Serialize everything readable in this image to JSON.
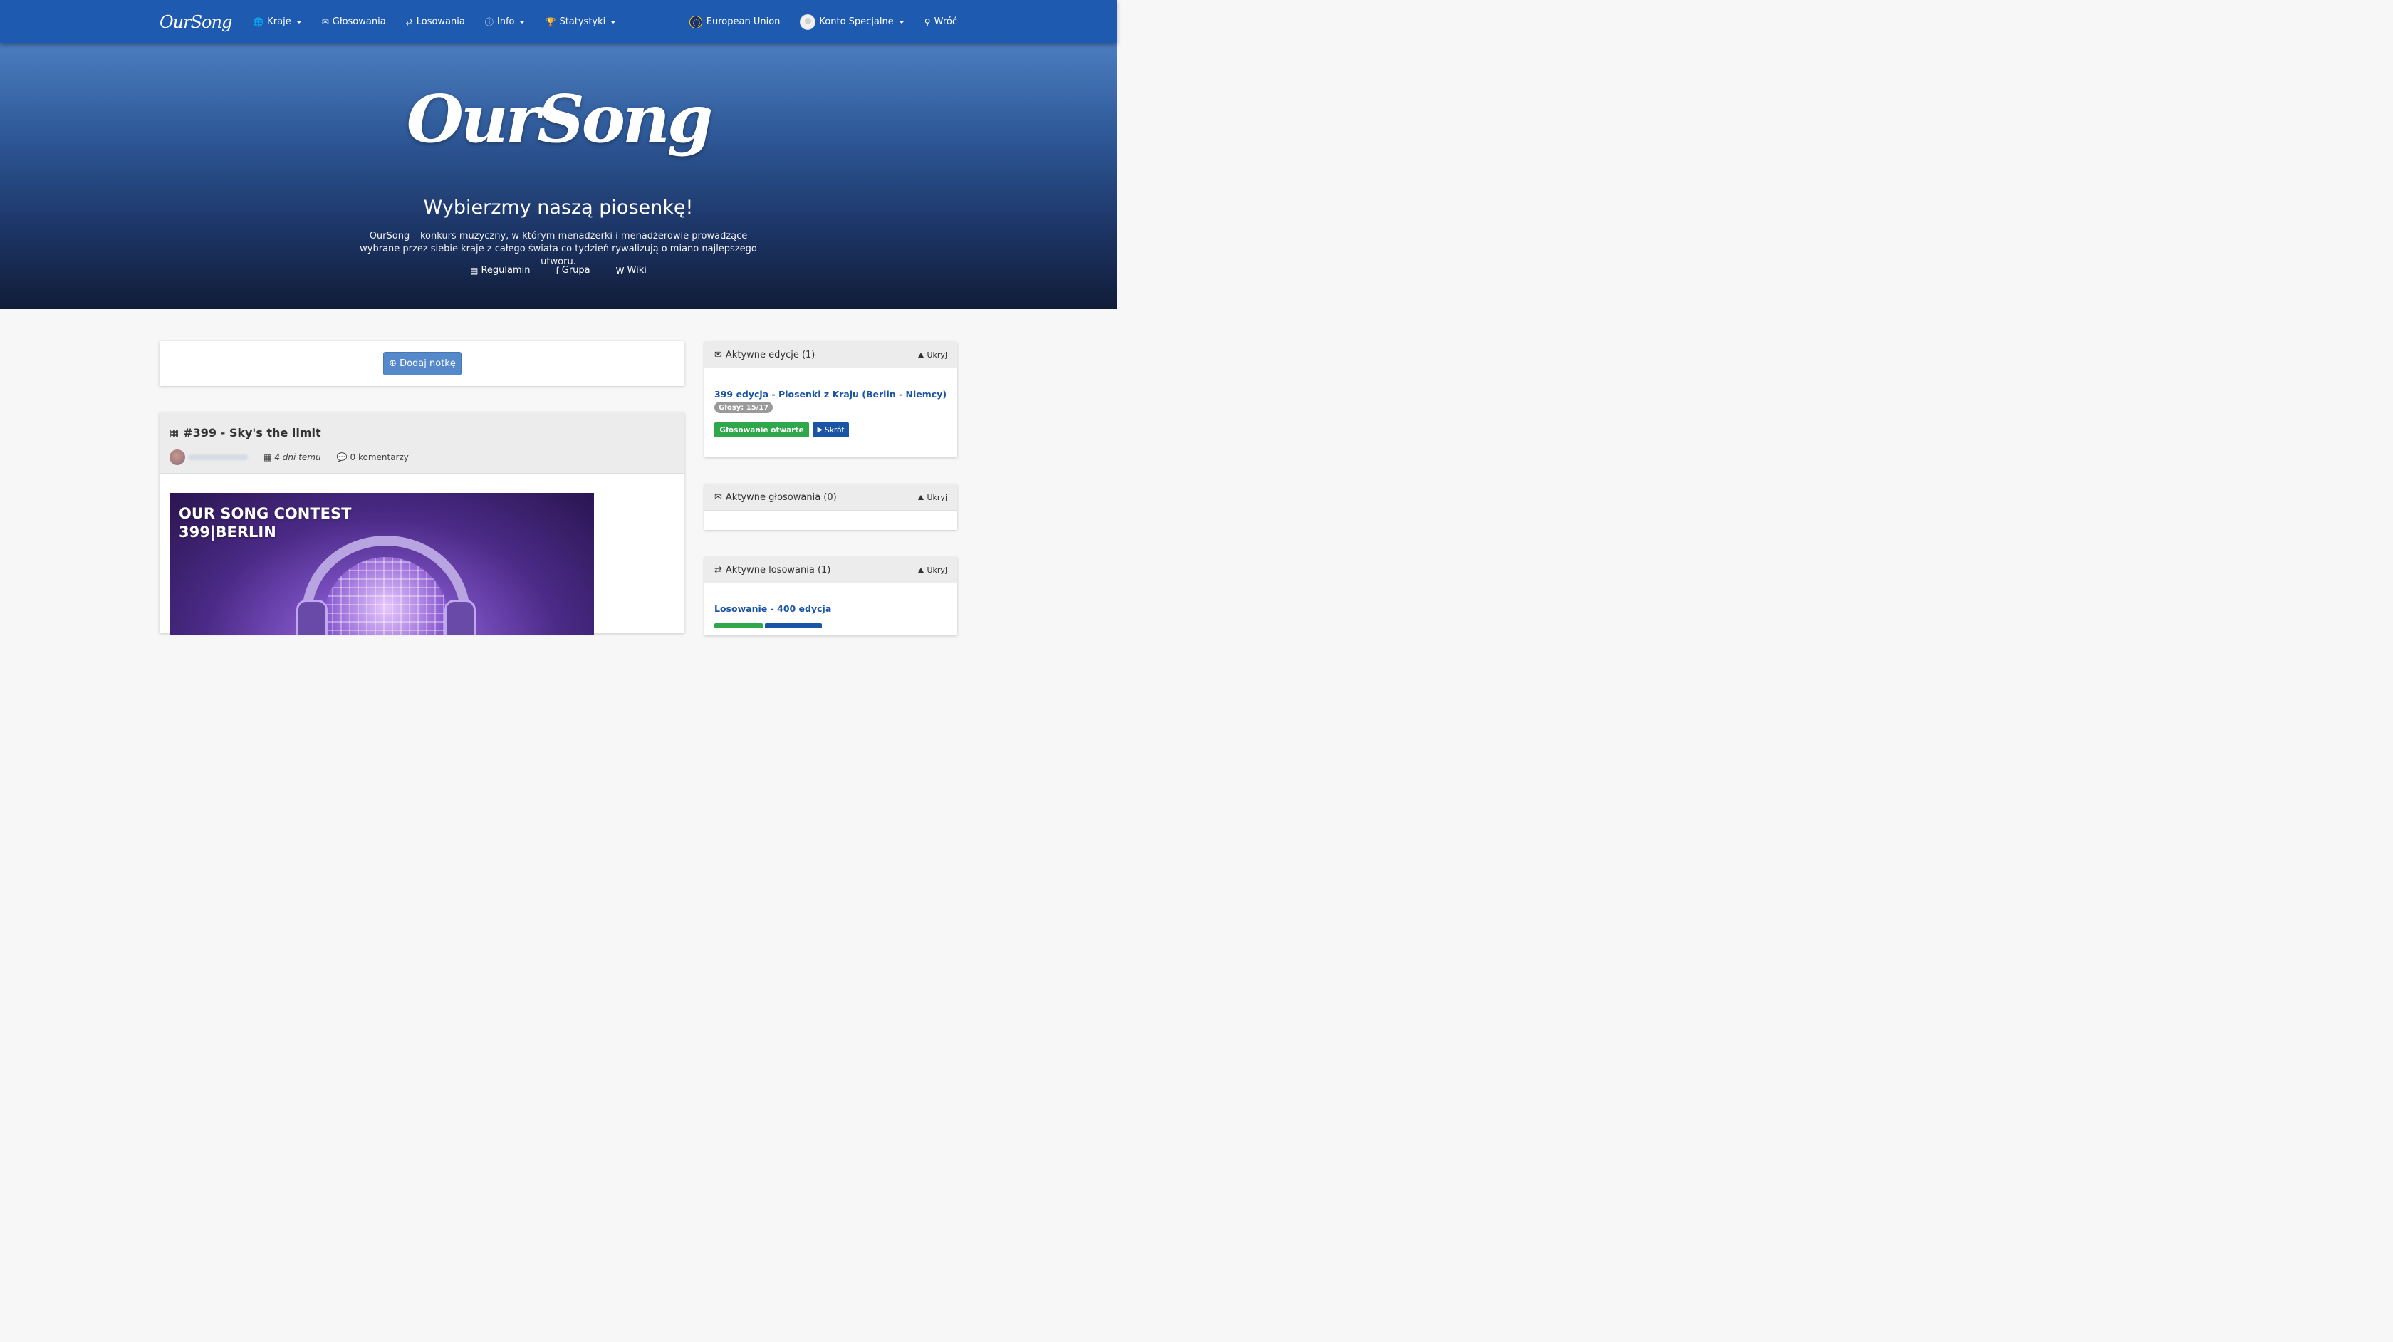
{
  "navbar": {
    "brand": "OurSong",
    "items": [
      {
        "label": "Kraje",
        "icon": "globe-icon",
        "glyph": "🌐",
        "dropdown": true
      },
      {
        "label": "Głosowania",
        "icon": "envelope-icon",
        "glyph": "✉",
        "dropdown": false
      },
      {
        "label": "Losowania",
        "icon": "shuffle-icon",
        "glyph": "⇄",
        "dropdown": false
      },
      {
        "label": "Info",
        "icon": "info-icon",
        "glyph": "ⓘ",
        "dropdown": true
      },
      {
        "label": "Statystyki",
        "icon": "trophy-icon",
        "glyph": "🏆",
        "dropdown": true
      }
    ],
    "country": "European Union",
    "account": "Konto Specjalne",
    "back": "Wróć",
    "back_glyph": "⚲"
  },
  "hero": {
    "logo": "OurSong",
    "tagline": "Wybierzmy naszą piosenkę!",
    "description": "OurSong – konkurs muzyczny, w którym menadżerki i menadżerowie prowadzące wybrane przez siebie kraje z całego świata co tydzień rywalizują o miano najlepszego utworu.",
    "links": [
      {
        "label": "Regulamin",
        "icon": "document-icon",
        "glyph": "▤"
      },
      {
        "label": "Grupa",
        "icon": "facebook-icon",
        "glyph": "f"
      },
      {
        "label": "Wiki",
        "icon": "wikipedia-icon",
        "glyph": "W"
      }
    ]
  },
  "main": {
    "add_note_label": "Dodaj notkę",
    "add_note_glyph": "⊕",
    "post": {
      "title": "#399 - Sky's the limit",
      "title_glyph": "▦",
      "date": "4 dni temu",
      "date_glyph": "▦",
      "comments": "0 komentarzy",
      "comments_glyph": "💬",
      "image_text_line1": "OUR SONG CONTEST",
      "image_text_line2": "399|BERLIN"
    }
  },
  "sidebar": {
    "hide_label": "Ukryj",
    "active_editions": {
      "title": "Aktywne edycje (1)",
      "glyph": "✉",
      "edition_link": "399 edycja - Piosenki z Kraju (Berlin - Niemcy)",
      "votes_badge": "Głosy: 15/17",
      "status_badge": "Głosowanie otwarte",
      "shortcut_label": "Skrót",
      "shortcut_glyph": "▶"
    },
    "active_votes": {
      "title": "Aktywne głosowania (0)",
      "glyph": "✉"
    },
    "active_draws": {
      "title": "Aktywne losowania (1)",
      "glyph": "⇄",
      "draw_link": "Losowanie - 400 edycja"
    }
  }
}
